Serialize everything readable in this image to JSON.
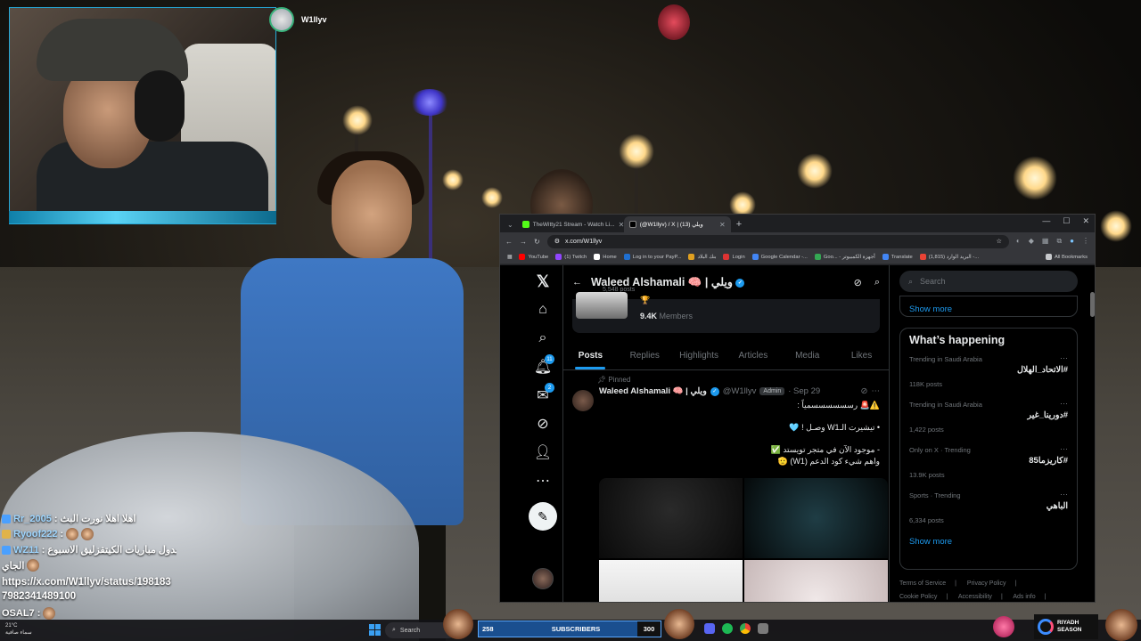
{
  "stream": {
    "channel_name": "W1llyv"
  },
  "chat": [
    {
      "user": "Rr_2005",
      "text": "اهلا اهلا نورت البث",
      "badge_color": "#4aa0ff"
    },
    {
      "user": "Ryoof222",
      "text": "",
      "badge_color": "#e0b34a"
    },
    {
      "user": "WZ11",
      "text": "جدول مباريات الكيتقزليق الاسبوع",
      "badge_color": "#4aa0ff"
    },
    {
      "user": "",
      "text": "الجاي",
      "badge_color": ""
    },
    {
      "user": "",
      "text": "https://x.com/W1llyv/status/1981837982341489100",
      "badge_color": ""
    },
    {
      "user": "OSAL7",
      "text": "",
      "badge_color": "#e0b34a"
    }
  ],
  "browser": {
    "tabs": [
      {
        "label": "TheWitty21 Stream - Watch Li...",
        "active": false,
        "color": "#53fc18"
      },
      {
        "label": "(@W1llyv) / X | ويلي (13)",
        "active": true,
        "color": "#ffffff"
      }
    ],
    "url": "x.com/W1llyv",
    "bookmarks": [
      {
        "label": "YouTube",
        "color": "#ff0000"
      },
      {
        "label": "(1) Twitch",
        "color": "#9146ff"
      },
      {
        "label": "Home",
        "color": "#ffffff"
      },
      {
        "label": "Log in to your PayP...",
        "color": "#1f6fd0"
      },
      {
        "label": "بنك البلاد",
        "color": "#e0a020"
      },
      {
        "label": "Login",
        "color": "#d33"
      },
      {
        "label": "Google Calendar -...",
        "color": "#4285f4"
      },
      {
        "label": "Goo... - أجهزة الكمبيوتر",
        "color": "#34a853"
      },
      {
        "label": "Translate",
        "color": "#4285f4"
      },
      {
        "label": "(1,815) البريد الوارد -...",
        "color": "#ea4335"
      }
    ],
    "all_bookmarks": "All Bookmarks"
  },
  "x": {
    "profile_name": "Waleed Alshamali 🧠 | ويلي",
    "posts_count": "5,548 posts",
    "members": "9.4K",
    "members_label": "Members",
    "tabs": [
      "Posts",
      "Replies",
      "Highlights",
      "Articles",
      "Media",
      "Likes"
    ],
    "active_tab": "Posts",
    "nav_badges": {
      "notifications": "11",
      "messages": "2"
    },
    "pinned_label": "Pinned",
    "tweet": {
      "name": "Waleed Alshamali 🧠 | ويلي",
      "handle": "@W1llyv",
      "role": "Admin",
      "date": "· Sep 29",
      "lines": [
        "⚠️🚨 رسسسسسسمياً :",
        "• تيشيرت الـW1 وصـل ! 🩵",
        "- موجود الآن في متجر تويستد ✅",
        "واهم شيء كود الدعم (W1) 🫡"
      ]
    },
    "search_placeholder": "Search",
    "show_more": "Show more",
    "whats_happening": "What’s happening",
    "trends": [
      {
        "context": "Trending in Saudi Arabia",
        "title": "#الاتحاد_الهلال",
        "count": "118K posts"
      },
      {
        "context": "Trending in Saudi Arabia",
        "title": "#دورينا_غير",
        "count": "1,422 posts"
      },
      {
        "context": "Only on X · Trending",
        "title": "#كاريزما85",
        "count": "13.9K posts"
      },
      {
        "context": "Sports · Trending",
        "title": "الباهي",
        "count": "6,334 posts"
      }
    ],
    "footer": [
      "Terms of Service",
      "Privacy Policy",
      "Cookie Policy",
      "Accessibility",
      "Ads info"
    ]
  },
  "taskbar": {
    "weather_temp": "21°C",
    "weather_text": "سماء صافية",
    "search_label": "Search",
    "subs_left": "258",
    "subs_center": "SUBSCRIBERS",
    "subs_right": "300",
    "subs_progress": 0.86,
    "riyadh_line1": "RIYADH",
    "riyadh_line2": "SEASON"
  }
}
